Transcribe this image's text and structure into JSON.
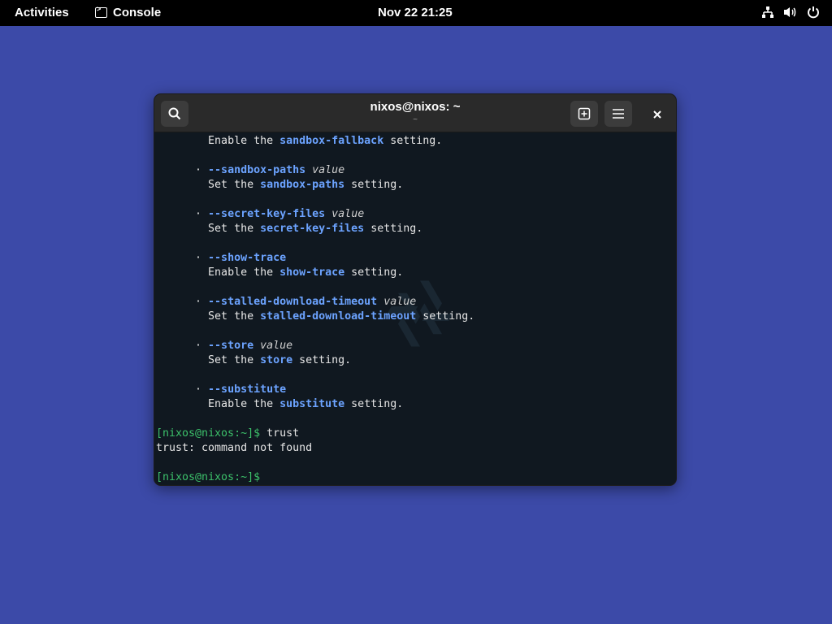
{
  "topbar": {
    "activities": "Activities",
    "app_name": "Console",
    "clock": "Nov 22  21:25"
  },
  "window": {
    "title": "nixos@nixos: ~",
    "subtitle": "~"
  },
  "terminal": {
    "lines": [
      {
        "indent": "        ",
        "parts": [
          {
            "t": "Enable the "
          },
          {
            "t": "sandbox-fallback",
            "c": "opt"
          },
          {
            "t": " setting."
          }
        ]
      },
      {
        "indent": "",
        "parts": []
      },
      {
        "indent": "      · ",
        "parts": [
          {
            "t": "--sandbox-paths",
            "c": "opt"
          },
          {
            "t": " "
          },
          {
            "t": "value",
            "c": "em"
          }
        ]
      },
      {
        "indent": "        ",
        "parts": [
          {
            "t": "Set the "
          },
          {
            "t": "sandbox-paths",
            "c": "opt"
          },
          {
            "t": " setting."
          }
        ]
      },
      {
        "indent": "",
        "parts": []
      },
      {
        "indent": "      · ",
        "parts": [
          {
            "t": "--secret-key-files",
            "c": "opt"
          },
          {
            "t": " "
          },
          {
            "t": "value",
            "c": "em"
          }
        ]
      },
      {
        "indent": "        ",
        "parts": [
          {
            "t": "Set the "
          },
          {
            "t": "secret-key-files",
            "c": "opt"
          },
          {
            "t": " setting."
          }
        ]
      },
      {
        "indent": "",
        "parts": []
      },
      {
        "indent": "      · ",
        "parts": [
          {
            "t": "--show-trace",
            "c": "opt"
          }
        ]
      },
      {
        "indent": "        ",
        "parts": [
          {
            "t": "Enable the "
          },
          {
            "t": "show-trace",
            "c": "opt"
          },
          {
            "t": " setting."
          }
        ]
      },
      {
        "indent": "",
        "parts": []
      },
      {
        "indent": "      · ",
        "parts": [
          {
            "t": "--stalled-download-timeout",
            "c": "opt"
          },
          {
            "t": " "
          },
          {
            "t": "value",
            "c": "em"
          }
        ]
      },
      {
        "indent": "        ",
        "parts": [
          {
            "t": "Set the "
          },
          {
            "t": "stalled-download-timeout",
            "c": "opt"
          },
          {
            "t": " setting."
          }
        ]
      },
      {
        "indent": "",
        "parts": []
      },
      {
        "indent": "      · ",
        "parts": [
          {
            "t": "--store",
            "c": "opt"
          },
          {
            "t": " "
          },
          {
            "t": "value",
            "c": "em"
          }
        ]
      },
      {
        "indent": "        ",
        "parts": [
          {
            "t": "Set the "
          },
          {
            "t": "store",
            "c": "opt"
          },
          {
            "t": " setting."
          }
        ]
      },
      {
        "indent": "",
        "parts": []
      },
      {
        "indent": "      · ",
        "parts": [
          {
            "t": "--substitute",
            "c": "opt"
          }
        ]
      },
      {
        "indent": "        ",
        "parts": [
          {
            "t": "Enable the "
          },
          {
            "t": "substitute",
            "c": "opt"
          },
          {
            "t": " setting."
          }
        ]
      },
      {
        "indent": "",
        "parts": []
      },
      {
        "indent": "",
        "parts": [
          {
            "t": "[nixos@nixos:~]$",
            "c": "prompt"
          },
          {
            "t": " trust"
          }
        ]
      },
      {
        "indent": "",
        "parts": [
          {
            "t": "trust: command not found"
          }
        ]
      },
      {
        "indent": "",
        "parts": []
      },
      {
        "indent": "",
        "parts": [
          {
            "t": "[nixos@nixos:~]$",
            "c": "prompt"
          },
          {
            "t": " "
          }
        ]
      }
    ]
  },
  "colors": {
    "desktop": "#3c4aa8",
    "terminal_bg": "#101820",
    "option": "#6ca3ff",
    "prompt": "#3cc06a"
  }
}
